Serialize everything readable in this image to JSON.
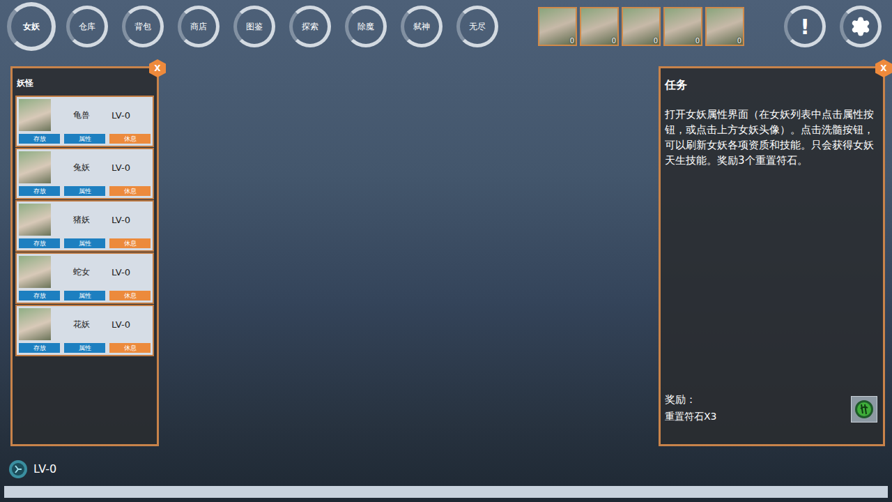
{
  "nav": [
    {
      "label": "女妖",
      "selected": true
    },
    {
      "label": "仓库",
      "selected": false
    },
    {
      "label": "背包",
      "selected": false
    },
    {
      "label": "商店",
      "selected": false
    },
    {
      "label": "图鉴",
      "selected": false
    },
    {
      "label": "探索",
      "selected": false
    },
    {
      "label": "除魔",
      "selected": false
    },
    {
      "label": "弑神",
      "selected": false
    },
    {
      "label": "无尽",
      "selected": false
    }
  ],
  "portraits": [
    {
      "count": "0"
    },
    {
      "count": "0"
    },
    {
      "count": "0"
    },
    {
      "count": "0"
    },
    {
      "count": "0"
    }
  ],
  "alert": "!",
  "monster_panel": {
    "title": "妖怪",
    "close": "X",
    "items": [
      {
        "name": "龟兽",
        "level": "LV-0",
        "buttons": [
          {
            "label": "存放",
            "color": "#1d7fc0"
          },
          {
            "label": "属性",
            "color": "#1d7fc0"
          },
          {
            "label": "休息",
            "color": "#ec8a3c"
          }
        ]
      },
      {
        "name": "兔妖",
        "level": "LV-0",
        "buttons": [
          {
            "label": "存放",
            "color": "#1d7fc0"
          },
          {
            "label": "属性",
            "color": "#1d7fc0"
          },
          {
            "label": "休息",
            "color": "#ec8a3c"
          }
        ]
      },
      {
        "name": "猪妖",
        "level": "LV-0",
        "buttons": [
          {
            "label": "存放",
            "color": "#1d7fc0"
          },
          {
            "label": "属性",
            "color": "#1d7fc0"
          },
          {
            "label": "休息",
            "color": "#ec8a3c"
          }
        ]
      },
      {
        "name": "蛇女",
        "level": "LV-0",
        "buttons": [
          {
            "label": "存放",
            "color": "#1d7fc0"
          },
          {
            "label": "属性",
            "color": "#1d7fc0"
          },
          {
            "label": "休息",
            "color": "#ec8a3c"
          }
        ]
      },
      {
        "name": "花妖",
        "level": "LV-0",
        "buttons": [
          {
            "label": "存放",
            "color": "#1d7fc0"
          },
          {
            "label": "属性",
            "color": "#1d7fc0"
          },
          {
            "label": "休息",
            "color": "#ec8a3c"
          }
        ]
      }
    ]
  },
  "task_panel": {
    "title": "任务",
    "close": "X",
    "description": "打开女妖属性界面（在女妖列表中点击属性按钮，或点击上方女妖头像）。点击洗髓按钮，可以刷新女妖各项资质和技能。只会获得女妖天生技能。奖励3个重置符石。",
    "reward_label": "奖励：",
    "reward": "重置符石X3"
  },
  "player": {
    "level": "LV-0",
    "progress": 0
  }
}
